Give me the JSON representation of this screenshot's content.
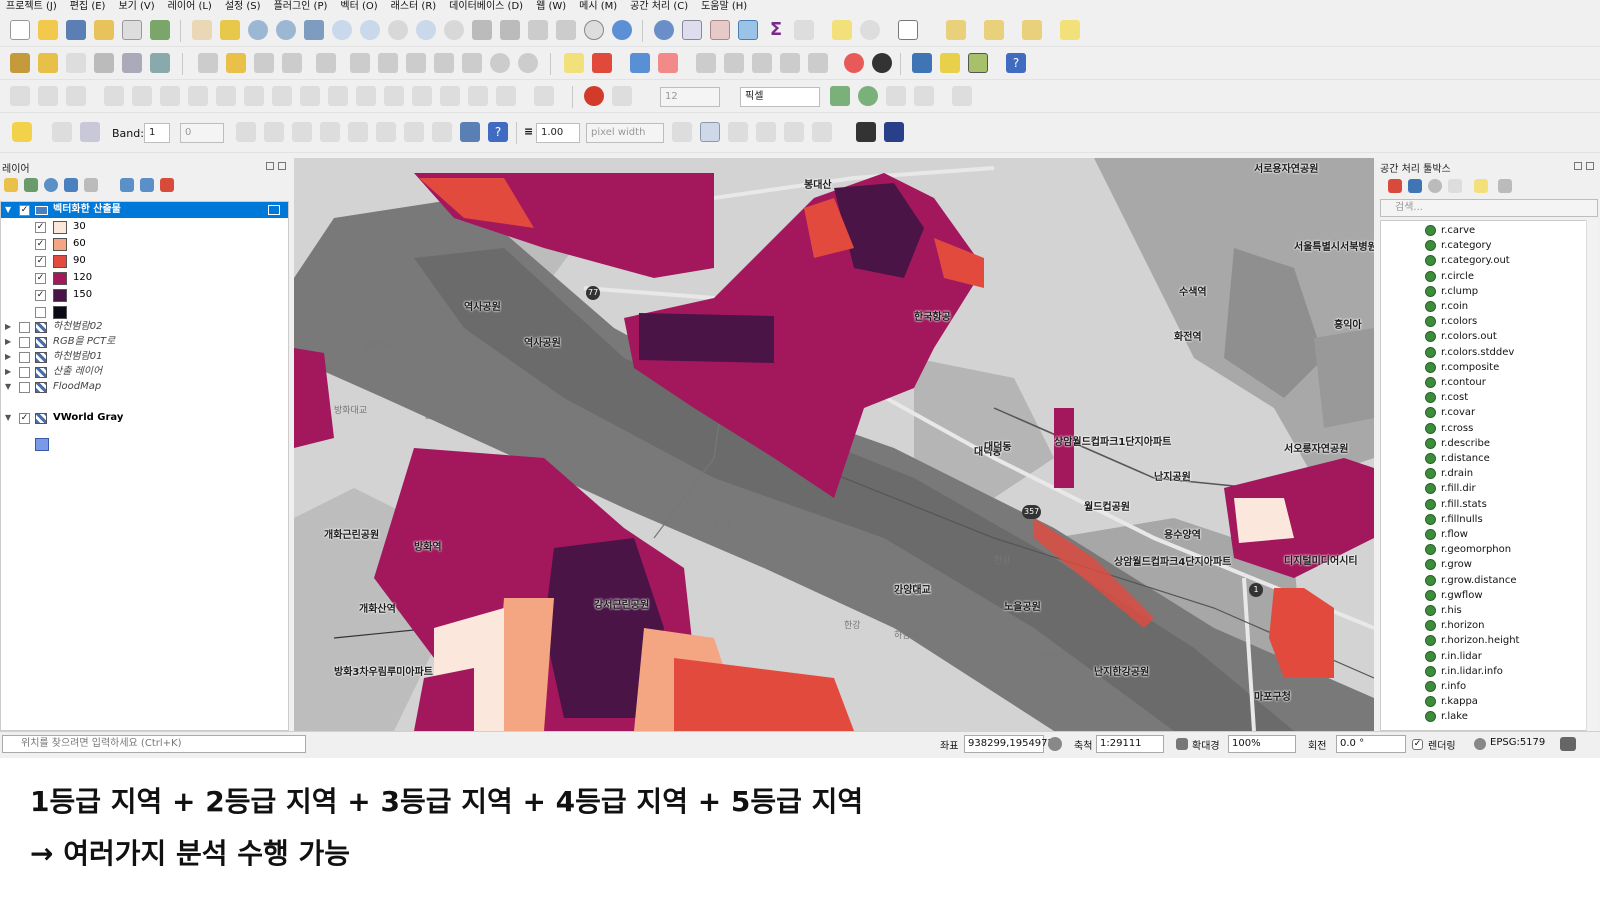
{
  "menu": [
    "프로젝트 (J)",
    "편집 (E)",
    "보기 (V)",
    "레이어 (L)",
    "설정 (S)",
    "플러그인 (P)",
    "벡터 (O)",
    "래스터 (R)",
    "데이터베이스 (D)",
    "웹 (W)",
    "메시 (M)",
    "공간 처리 (C)",
    "도움말 (H)"
  ],
  "toolbar": {
    "snap_value": "12",
    "snap_unit": "픽셀",
    "band_label": "Band:",
    "band_value": "1",
    "band_extra": "0",
    "width_value": "1.00",
    "width_unit": "pixel width"
  },
  "layers_panel": {
    "title": "레이어",
    "group_title": "벡터화한 산출물",
    "classes": [
      {
        "label": "30",
        "color": "#fce7dc"
      },
      {
        "label": "60",
        "color": "#f4a582"
      },
      {
        "label": "90",
        "color": "#e34a3e"
      },
      {
        "label": "120",
        "color": "#a3175c"
      },
      {
        "label": "150",
        "color": "#4a1446"
      },
      {
        "label": "",
        "color": "#0a0a16"
      }
    ],
    "layers": [
      {
        "name": "하천범람02",
        "checked": false
      },
      {
        "name": "RGB을 PCT로",
        "checked": false
      },
      {
        "name": "하천범람01",
        "checked": false
      },
      {
        "name": "산출 레이어",
        "checked": false
      },
      {
        "name": "FloodMap",
        "checked": false
      },
      {
        "name": "VWorld Gray",
        "checked": true
      }
    ]
  },
  "toolbox": {
    "title": "공간 처리 툴박스",
    "search_placeholder": "검색...",
    "items": [
      "r.carve",
      "r.category",
      "r.category.out",
      "r.circle",
      "r.clump",
      "r.coin",
      "r.colors",
      "r.colors.out",
      "r.colors.stddev",
      "r.composite",
      "r.contour",
      "r.cost",
      "r.covar",
      "r.cross",
      "r.describe",
      "r.distance",
      "r.drain",
      "r.fill.dir",
      "r.fill.stats",
      "r.fillnulls",
      "r.flow",
      "r.geomorphon",
      "r.grow",
      "r.grow.distance",
      "r.gwflow",
      "r.his",
      "r.horizon",
      "r.horizon.height",
      "r.in.lidar",
      "r.in.lidar.info",
      "r.info",
      "r.kappa",
      "r.lake"
    ]
  },
  "map": {
    "labels": [
      "봉대산",
      "역사공원",
      "역사공원",
      "한국항공",
      "개화근린공원",
      "방화역",
      "개화산역",
      "방화3차우림루미아파트",
      "강서근린공원",
      "양천향교",
      "대덕동",
      "상암월드컵파크1단지아파트",
      "상암월드컵파크4단지아파트",
      "노을공원",
      "난지한강공원",
      "서울특별시서북병원",
      "수색역",
      "화전역",
      "서오릉자연공원",
      "난지공원",
      "홍익아",
      "디지털미디어시티",
      "마포구청",
      "서로용자연공원",
      "가양대교",
      "한강",
      "한강",
      "한강",
      "강변북로",
      "방화대교",
      "행주대교",
      "하남대교",
      "한강",
      "한강",
      "용수양역",
      "월드컵공원",
      "대덕동"
    ],
    "road_numbers": [
      "77",
      "1",
      "357"
    ]
  },
  "statusbar": {
    "locate_placeholder": "위치를 찾으려면 입력하세요 (Ctrl+K)",
    "coord_label": "좌표",
    "coord_value": "938299,1954972",
    "scale_label": "축척",
    "scale_value": "1:29111",
    "magnifier_label": "확대경",
    "magnifier_value": "100%",
    "rotation_label": "회전",
    "rotation_value": "0.0 °",
    "render_label": "렌더링",
    "crs": "EPSG:5179"
  },
  "caption": {
    "line1": "1등급 지역 + 2등급 지역 + 3등급 지역 + 4등급 지역 + 5등급 지역",
    "line2": "→ 여러가지 분석 수행 가능"
  }
}
